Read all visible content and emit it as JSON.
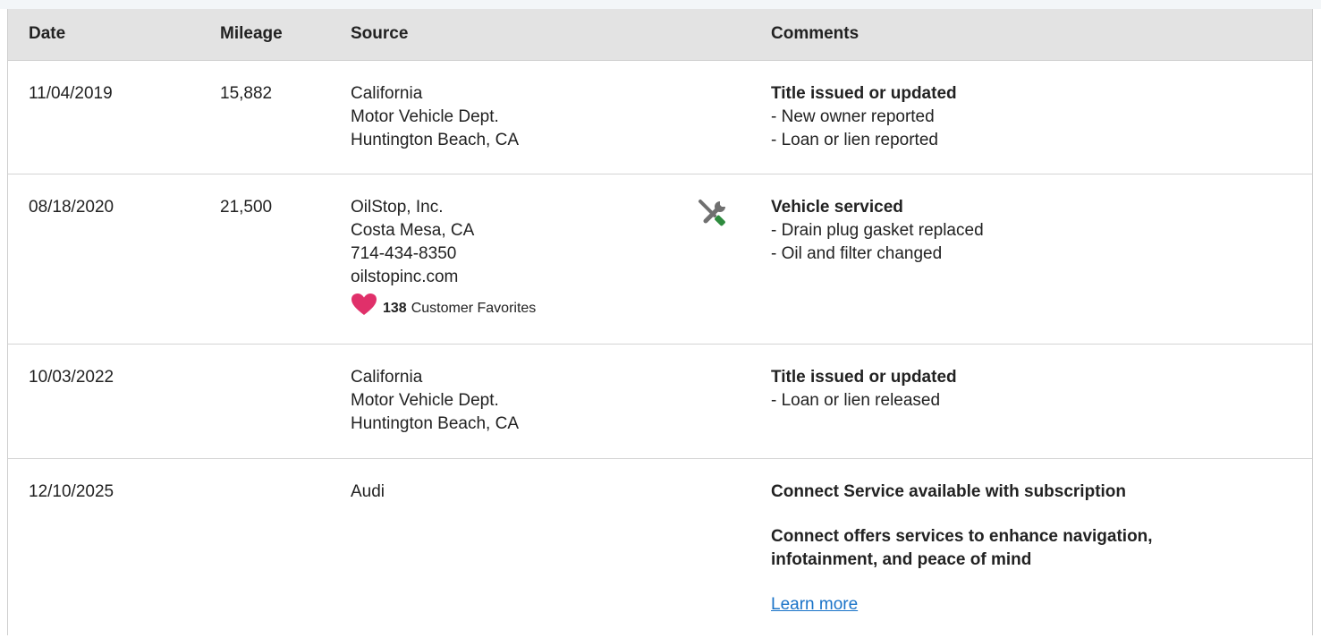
{
  "table": {
    "headers": {
      "date": "Date",
      "mileage": "Mileage",
      "source": "Source",
      "comments": "Comments"
    },
    "rows": [
      {
        "date": "11/04/2019",
        "mileage": "15,882",
        "source": [
          "California",
          "Motor Vehicle Dept.",
          "Huntington Beach, CA"
        ],
        "comment_title": "Title issued or updated",
        "comment_items": [
          "- New owner reported",
          "- Loan or lien reported"
        ]
      },
      {
        "date": "08/18/2020",
        "mileage": "21,500",
        "source": [
          "OilStop, Inc.",
          "Costa Mesa, CA",
          "714-434-8350",
          "oilstopinc.com"
        ],
        "favorites_count": "138",
        "favorites_label": "Customer Favorites",
        "icon": "service-tools-icon",
        "comment_title": "Vehicle serviced",
        "comment_items": [
          "- Drain plug gasket replaced",
          "- Oil and filter changed"
        ]
      },
      {
        "date": "10/03/2022",
        "mileage": "",
        "source": [
          "California",
          "Motor Vehicle Dept.",
          "Huntington Beach, CA"
        ],
        "comment_title": "Title issued or updated",
        "comment_items": [
          "- Loan or lien released"
        ]
      },
      {
        "date": "12/10/2025",
        "mileage": "",
        "source": [
          "Audi"
        ],
        "comment_title": "Connect Service available with subscription",
        "comment_para": [
          "Connect offers services to enhance navigation,",
          "infotainment, and peace of mind"
        ],
        "link": "Learn more"
      }
    ]
  },
  "colors": {
    "header_bg": "#e3e3e3",
    "heart": "#e0306a",
    "link": "#1a73c8",
    "wrench": "#2e8b3e",
    "screwdriver": "#707070"
  }
}
